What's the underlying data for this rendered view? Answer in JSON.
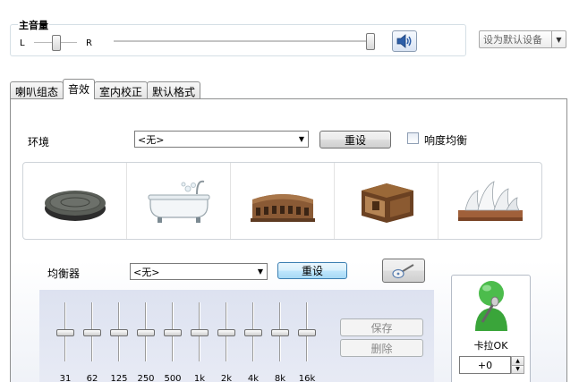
{
  "master": {
    "title": "主音量",
    "left_label": "L",
    "right_label": "R",
    "default_device_label": "设为默认设备"
  },
  "tabs": [
    {
      "label": "喇叭组态",
      "active": false
    },
    {
      "label": "音效",
      "active": true
    },
    {
      "label": "室内校正",
      "active": false
    },
    {
      "label": "默认格式",
      "active": false
    }
  ],
  "environment": {
    "label": "环境",
    "selected": "<无>",
    "reset_label": "重设",
    "loudness_label": "响度均衡",
    "loudness_checked": false,
    "presets": [
      {
        "icon": "stone-disc-icon"
      },
      {
        "icon": "bathtub-icon"
      },
      {
        "icon": "colosseum-icon"
      },
      {
        "icon": "wooden-box-icon"
      },
      {
        "icon": "opera-house-icon"
      }
    ]
  },
  "equalizer": {
    "label": "均衡器",
    "selected": "<无>",
    "reset_label": "重设",
    "save_label": "保存",
    "delete_label": "删除",
    "bands": [
      "31",
      "62",
      "125",
      "250",
      "500",
      "1k",
      "2k",
      "4k",
      "8k",
      "16k"
    ]
  },
  "karaoke": {
    "label": "卡拉OK",
    "value": "+0"
  },
  "colors": {
    "accent": "#3c7fb1",
    "karaoke_green": "#3aa53a",
    "eq_background": "#e2e6f2"
  }
}
